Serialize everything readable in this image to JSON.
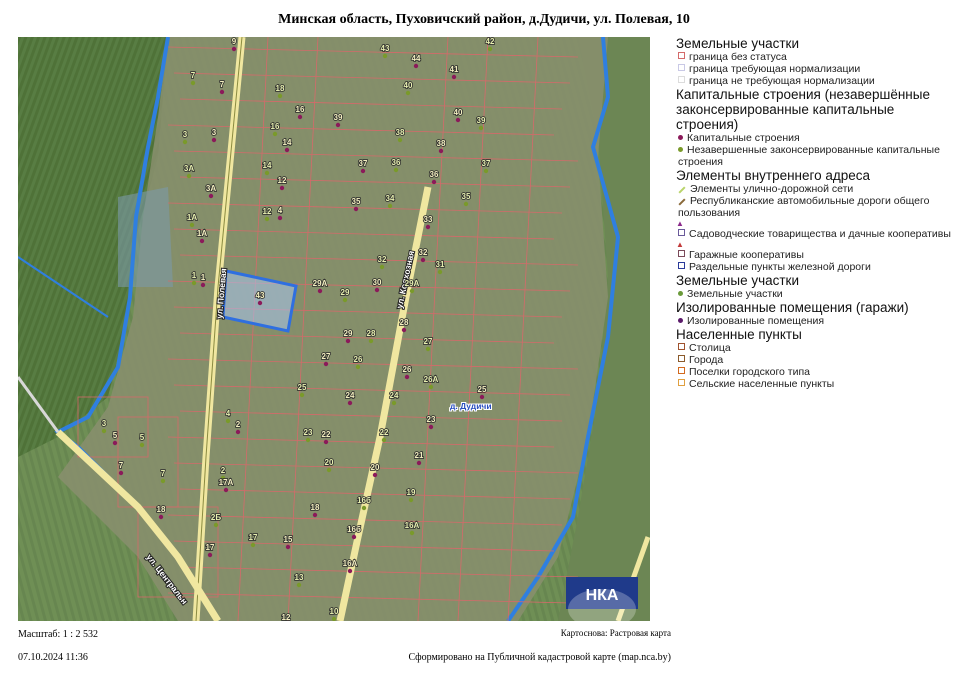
{
  "title": "Минская область, Пуховичский район, д.Дудичи, ул. Полевая, 10",
  "map": {
    "streets": [
      "ул. Полевая",
      "ул. Колхозная",
      "ул. Центральн"
    ],
    "settlement_label": "д. Дудичи",
    "logo_text": "НКА",
    "selected_parcel": "10",
    "parcel_numbers": [
      "9",
      "7",
      "7",
      "3",
      "3",
      "3А",
      "3А",
      "1А",
      "1А",
      "1",
      "1",
      "3",
      "5",
      "5",
      "7",
      "7",
      "18",
      "18",
      "16",
      "16",
      "14",
      "14",
      "12",
      "12",
      "4",
      "4",
      "2",
      "2",
      "17А",
      "2Б",
      "17",
      "17",
      "15",
      "13",
      "12",
      "10",
      "43",
      "43",
      "44",
      "42",
      "41",
      "40",
      "40",
      "39",
      "39",
      "38",
      "38",
      "37",
      "37",
      "36",
      "36",
      "35",
      "35",
      "34",
      "33",
      "32",
      "32",
      "31",
      "30",
      "29А",
      "29А",
      "29",
      "29",
      "28",
      "28",
      "27",
      "27",
      "26",
      "26",
      "26А",
      "25",
      "25",
      "24",
      "24",
      "23",
      "23",
      "22",
      "22",
      "21",
      "20",
      "20",
      "19",
      "18",
      "16б",
      "16б",
      "16А",
      "16А"
    ]
  },
  "legend": {
    "groups": [
      {
        "heading": "Земельные участки",
        "items": [
          {
            "label": "граница без статуса",
            "color": "#d46a6a",
            "kind": "square"
          },
          {
            "label": "граница требующая нормализации",
            "color": "#c9c9e6",
            "kind": "square"
          },
          {
            "label": "граница не требующая нормализации",
            "color": "#dcdcdc",
            "kind": "square"
          }
        ]
      },
      {
        "heading": "Капитальные строения (незавершённые законсервированные капитальные строения)",
        "items": [
          {
            "label": "Капитальные строения",
            "color": "#8b1a5a",
            "kind": "dot"
          },
          {
            "label": "Незавершенные законсервированные капитальные строения",
            "color": "#7a9a2a",
            "kind": "dot"
          }
        ]
      },
      {
        "heading": "Элементы внутреннего адреса",
        "items": [
          {
            "label": "Элементы улично-дорожной сети",
            "color": "#b9d46a",
            "kind": "line"
          },
          {
            "label": "Республиканские автомобильные дороги общего пользования",
            "color": "#8a6a3a",
            "kind": "line"
          },
          {
            "label": "",
            "color": "#8b2a8b",
            "kind": "icon"
          },
          {
            "label": "Садоводческие товарищества и дачные кооперативы",
            "color": "#6a5a9a",
            "kind": "square"
          },
          {
            "label": "",
            "color": "#c23a3a",
            "kind": "icon"
          },
          {
            "label": "Гаражные кооперативы",
            "color": "#7a4a5a",
            "kind": "square"
          },
          {
            "label": "Раздельные пункты железной дороги",
            "color": "#2a3a9a",
            "kind": "square"
          }
        ]
      },
      {
        "heading": "Земельные участки",
        "items": [
          {
            "label": "Земельные участки",
            "color": "#6a9a3a",
            "kind": "dot"
          }
        ]
      },
      {
        "heading": "Изолированные помещения (гаражи)",
        "items": [
          {
            "label": "Изолированные помещения",
            "color": "#5a1a6a",
            "kind": "dot"
          }
        ]
      },
      {
        "heading": "Населенные пункты",
        "items": [
          {
            "label": "Столица",
            "color": "#a0522d",
            "kind": "square"
          },
          {
            "label": "Города",
            "color": "#8b5a2b",
            "kind": "square"
          },
          {
            "label": "Поселки городского типа",
            "color": "#d2691e",
            "kind": "square"
          },
          {
            "label": "Сельские населенные пункты",
            "color": "#e0a040",
            "kind": "square"
          }
        ]
      }
    ]
  },
  "footer": {
    "scale": "Масштаб: 1 : 2 532",
    "basemap": "Картоснова: Растровая карта",
    "datetime": "07.10.2024 11:36",
    "source": "Сформировано на Публичной кадастровой карте (map.nca.by)"
  }
}
